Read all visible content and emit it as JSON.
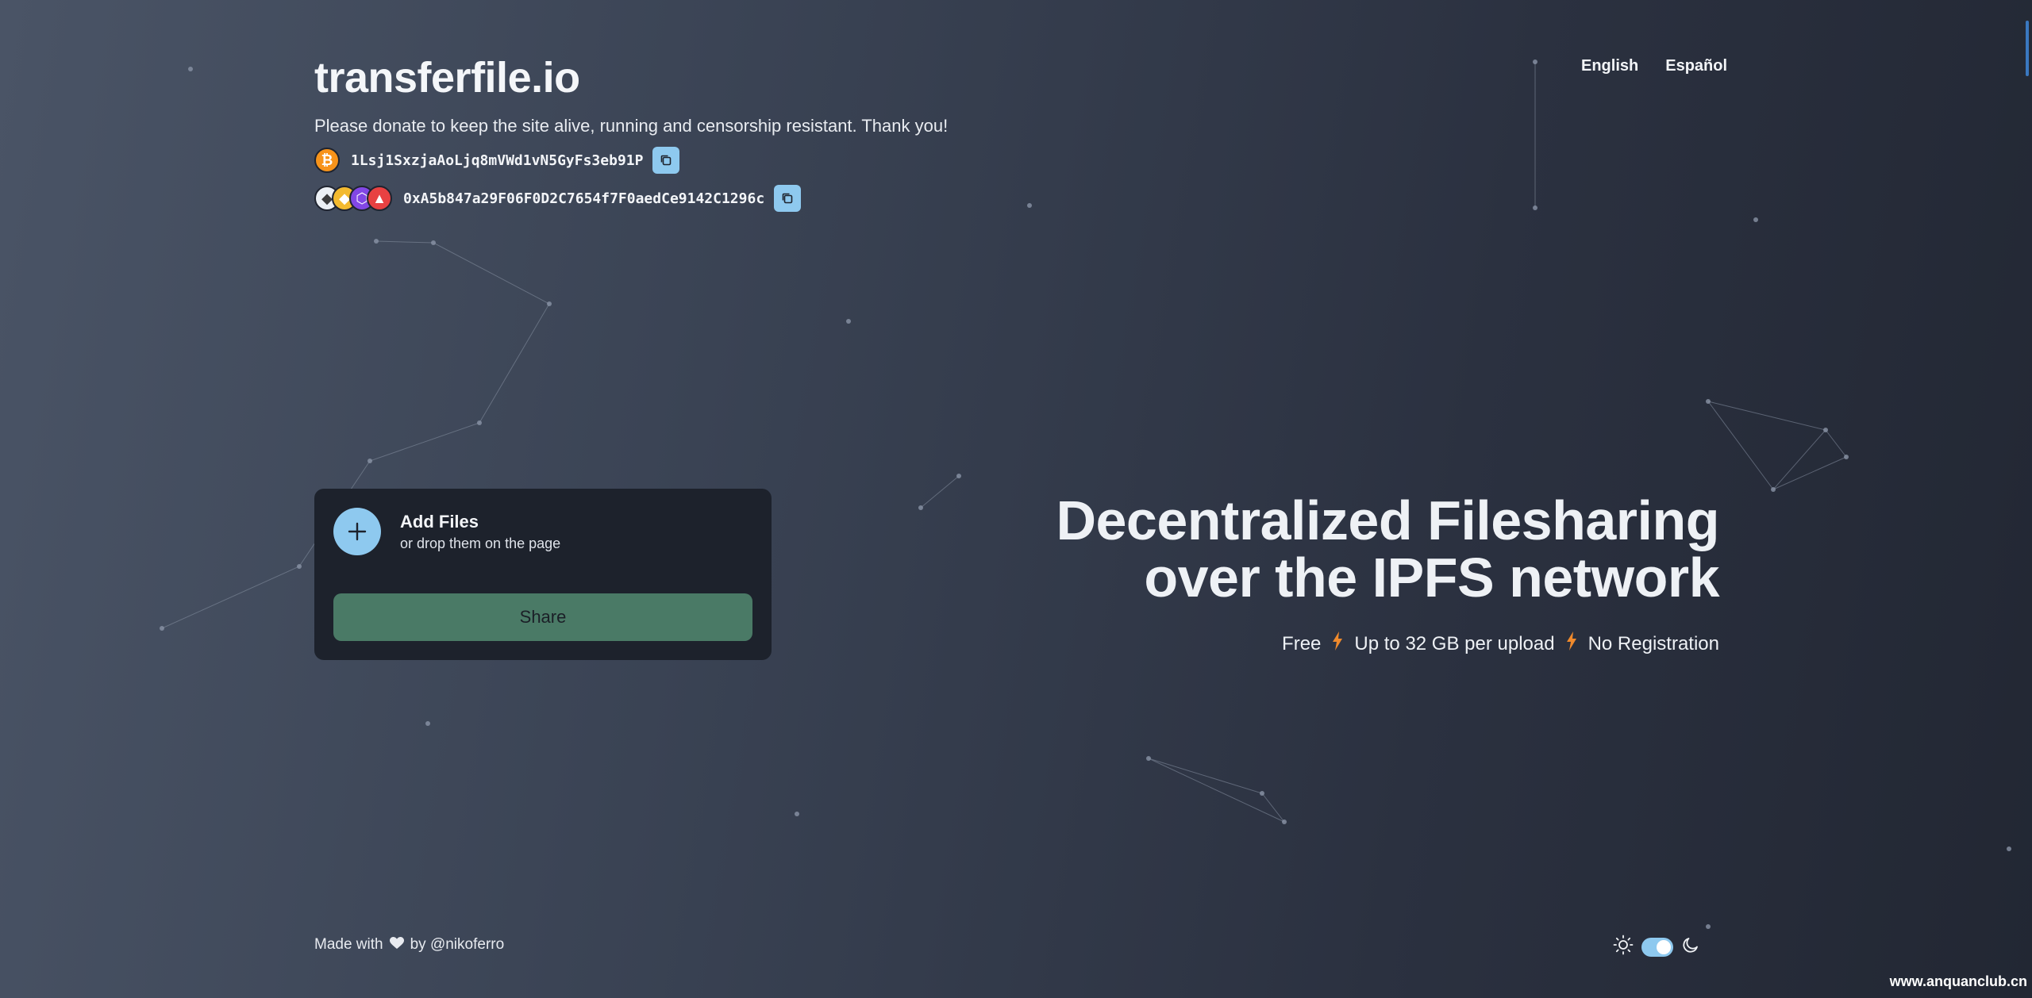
{
  "header": {
    "title": "transferfile.io",
    "donate_text": "Please donate to keep the site alive, running and censorship resistant. Thank you!",
    "btc_address": "1Lsj1SxzjaAoLjq8mVWd1vN5GyFs3eb91P",
    "evm_address": "0xA5b847a29F06F0D2C7654f7F0aedCe9142C1296c",
    "coins": {
      "btc": "₿",
      "eth": "◆",
      "bnb": "◆",
      "matic": "⬡",
      "avax": "▲"
    }
  },
  "languages": [
    {
      "label": "English"
    },
    {
      "label": "Español"
    }
  ],
  "upload": {
    "add_title": "Add Files",
    "add_subtitle": "or drop them on the page",
    "share_label": "Share"
  },
  "hero": {
    "line1": "Decentralized Filesharing",
    "line2": "over the IPFS network",
    "feature1": "Free",
    "feature2": "Up to 32 GB per upload",
    "feature3": "No Registration"
  },
  "footer": {
    "made_with": "Made with",
    "by": "by @nikoferro"
  },
  "watermark": "www.anquanclub.cn",
  "colors": {
    "accent_blue": "#8ec9ef",
    "share_green": "#4a7a66",
    "bolt_orange": "#f08a2c",
    "card_bg": "#1d222c"
  },
  "theme": {
    "mode": "dark"
  }
}
